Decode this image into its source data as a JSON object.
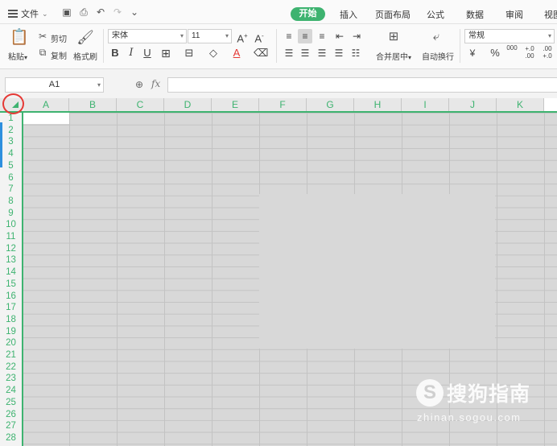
{
  "menu": {
    "file_label": "文件"
  },
  "tabs": [
    {
      "label": "开始",
      "active": true
    },
    {
      "label": "插入"
    },
    {
      "label": "页面布局"
    },
    {
      "label": "公式"
    },
    {
      "label": "数据"
    },
    {
      "label": "审阅"
    },
    {
      "label": "视图"
    }
  ],
  "ribbon": {
    "paste": "粘贴",
    "cut": "剪切",
    "copy": "复制",
    "format_painter": "格式刷",
    "font_name": "宋体",
    "font_size": "11",
    "merge_center": "合并居中",
    "wrap_text": "自动换行",
    "number_format": "常规",
    "thousands": "000",
    "inc_decimal": "+.0\n.00",
    "dec_decimal": ".00\n+.0"
  },
  "formula_bar": {
    "name_box": "A1",
    "fx_label": "fx",
    "formula": ""
  },
  "columns": [
    "A",
    "B",
    "C",
    "D",
    "E",
    "F",
    "G",
    "H",
    "I",
    "J",
    "K"
  ],
  "rows": [
    "1",
    "2",
    "3",
    "4",
    "5",
    "6",
    "7",
    "8",
    "9",
    "10",
    "11",
    "12",
    "13",
    "14",
    "15",
    "16",
    "17",
    "18",
    "19",
    "20",
    "21",
    "22",
    "23",
    "24",
    "25",
    "26",
    "27",
    "28"
  ],
  "watermark": {
    "text": "搜狗指南",
    "url": "zhinan.sogou.com",
    "logo": "S"
  },
  "colors": {
    "accent": "#3eb370",
    "highlight_ring": "#e53935",
    "grid_fill": "#d8d8d8"
  }
}
